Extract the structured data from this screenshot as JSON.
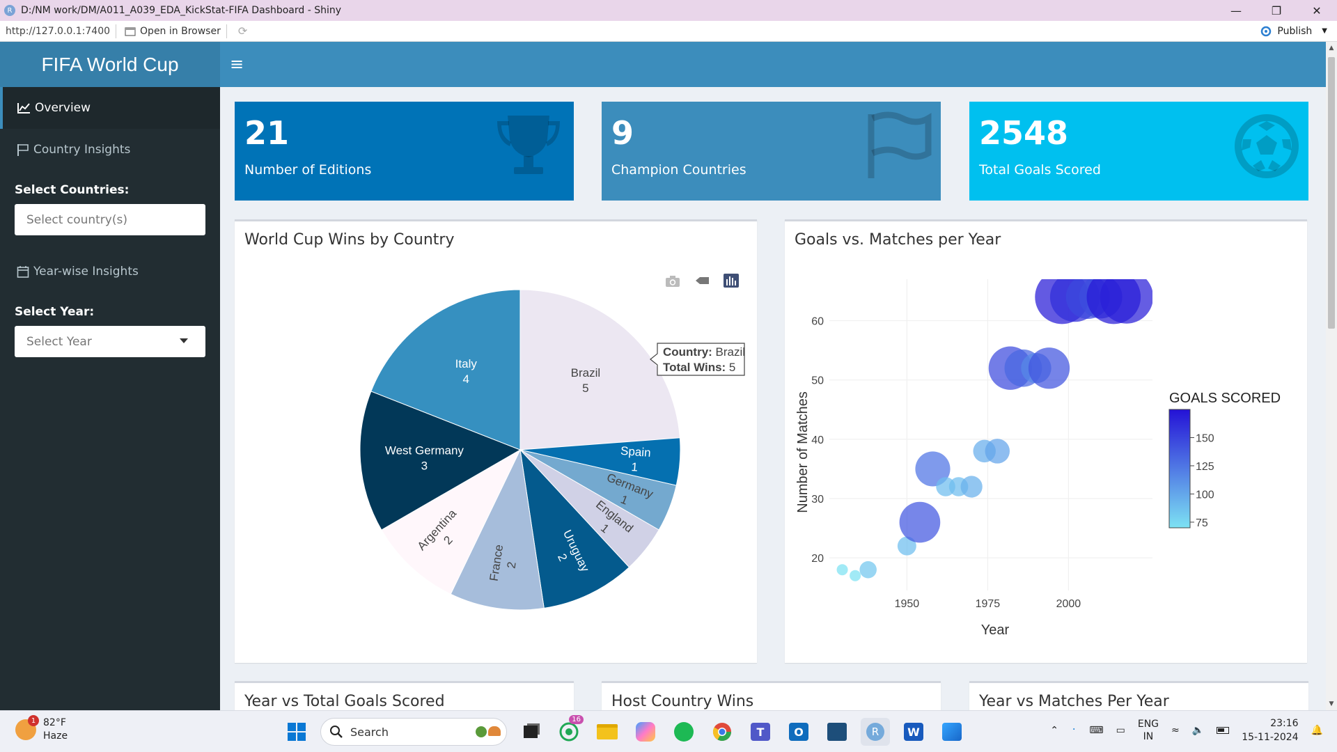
{
  "window": {
    "title": "D:/NM work/DM/A011_A039_EDA_KickStat-FIFA Dashboard - Shiny",
    "app_icon": "R"
  },
  "addressbar": {
    "url": "http://127.0.0.1:7400",
    "open_browser": "Open in Browser",
    "publish": "Publish"
  },
  "header": {
    "brand": "FIFA World Cup",
    "menu_icon": "≡"
  },
  "sidebar": {
    "overview": "Overview",
    "country_insights": "Country Insights",
    "select_countries_label": "Select Countries:",
    "select_countries_placeholder": "Select country(s)",
    "yearwise": "Year-wise Insights",
    "select_year_label": "Select Year:",
    "select_year_placeholder": "Select Year"
  },
  "valueboxes": [
    {
      "value": "21",
      "label": "Number of Editions",
      "color": "#0073b7",
      "icon": "trophy-icon"
    },
    {
      "value": "9",
      "label": "Champion Countries",
      "color": "#3c8dbc",
      "icon": "flag-icon"
    },
    {
      "value": "2548",
      "label": "Total Goals Scored",
      "color": "#00c0ef",
      "icon": "futbol-icon"
    }
  ],
  "pie_box": {
    "title": "World Cup Wins by Country"
  },
  "scatter_box": {
    "title": "Goals vs. Matches per Year"
  },
  "bottom_boxes": [
    "Year vs Total Goals Scored",
    "Host Country Wins",
    "Year vs Matches Per Year"
  ],
  "tooltip": {
    "country_label": "Country:",
    "country_value": "Brazil",
    "wins_label": "Total Wins:",
    "wins_value": "5"
  },
  "chart_data": [
    {
      "type": "pie",
      "title": "World Cup Wins by Country",
      "categories": [
        "Brazil",
        "Spain",
        "Germany",
        "England",
        "Uruguay",
        "France",
        "Argentina",
        "West Germany",
        "Italy"
      ],
      "values": [
        5,
        1,
        1,
        1,
        2,
        2,
        2,
        3,
        4
      ],
      "colors": [
        "#ece7f2",
        "#0570b0",
        "#74a9cf",
        "#d0d1e6",
        "#045a8d",
        "#a6bddb",
        "#fff7fb",
        "#023858",
        "#3690c0"
      ],
      "label_colors": [
        "#444",
        "#fff",
        "#444",
        "#444",
        "#fff",
        "#444",
        "#444",
        "#fff",
        "#fff"
      ]
    },
    {
      "type": "scatter",
      "title": "Goals vs. Matches per Year",
      "xlabel": "Year",
      "ylabel": "Number of Matches",
      "xlim": [
        1926,
        2026
      ],
      "ylim": [
        14.5,
        67
      ],
      "xticks": [
        1950,
        1975,
        2000
      ],
      "yticks": [
        20,
        30,
        40,
        50,
        60
      ],
      "colorbar_title": "GOALS SCORED",
      "colorbar_ticks": [
        75,
        100,
        125,
        150
      ],
      "points": [
        {
          "x": 1930,
          "y": 18,
          "goals": 70
        },
        {
          "x": 1934,
          "y": 17,
          "goals": 70
        },
        {
          "x": 1938,
          "y": 18,
          "goals": 84
        },
        {
          "x": 1950,
          "y": 22,
          "goals": 88
        },
        {
          "x": 1954,
          "y": 26,
          "goals": 140
        },
        {
          "x": 1958,
          "y": 35,
          "goals": 126
        },
        {
          "x": 1962,
          "y": 32,
          "goals": 89
        },
        {
          "x": 1966,
          "y": 32,
          "goals": 89
        },
        {
          "x": 1970,
          "y": 32,
          "goals": 95
        },
        {
          "x": 1974,
          "y": 38,
          "goals": 97
        },
        {
          "x": 1978,
          "y": 38,
          "goals": 102
        },
        {
          "x": 1982,
          "y": 52,
          "goals": 146
        },
        {
          "x": 1986,
          "y": 52,
          "goals": 132
        },
        {
          "x": 1990,
          "y": 52,
          "goals": 115
        },
        {
          "x": 1994,
          "y": 52,
          "goals": 141
        },
        {
          "x": 1998,
          "y": 64,
          "goals": 171
        },
        {
          "x": 2002,
          "y": 64,
          "goals": 161
        },
        {
          "x": 2006,
          "y": 64,
          "goals": 147
        },
        {
          "x": 2010,
          "y": 64,
          "goals": 145
        },
        {
          "x": 2014,
          "y": 64,
          "goals": 171
        },
        {
          "x": 2018,
          "y": 64,
          "goals": 169
        }
      ]
    }
  ],
  "taskbar": {
    "temp": "82°F",
    "condition": "Haze",
    "weather_badge": "1",
    "search": "Search",
    "whatsapp_badge": "16",
    "lang1": "ENG",
    "lang2": "IN",
    "time": "23:16",
    "date": "15-11-2024"
  }
}
